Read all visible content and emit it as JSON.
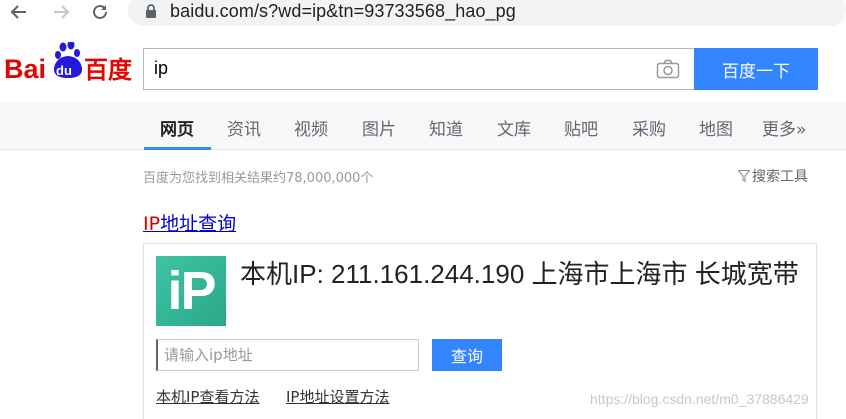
{
  "browser": {
    "url": "baidu.com/s?wd=ip&tn=93733568_hao_pg"
  },
  "header": {
    "logo_text_latin": "Bai",
    "logo_text_du": "du",
    "logo_text_cn": "百度",
    "search_value": "ip",
    "search_button": "百度一下"
  },
  "tabs": [
    {
      "label": "网页",
      "active": true
    },
    {
      "label": "资讯",
      "active": false
    },
    {
      "label": "视频",
      "active": false
    },
    {
      "label": "图片",
      "active": false
    },
    {
      "label": "知道",
      "active": false
    },
    {
      "label": "文库",
      "active": false
    },
    {
      "label": "贴吧",
      "active": false
    },
    {
      "label": "采购",
      "active": false
    },
    {
      "label": "地图",
      "active": false
    },
    {
      "label": "更多»",
      "active": false
    }
  ],
  "results": {
    "count_text": "百度为您找到相关结果约78,000,000个",
    "tools_label": "搜索工具"
  },
  "ip_card": {
    "title_em": "IP",
    "title_rest": "地址查询",
    "logo_text": "iP",
    "info_text": "本机IP: 211.161.244.190  上海市上海市 长城宽带",
    "input_placeholder": "请输入ip地址",
    "query_button": "查询",
    "link_1": "本机IP查看方法",
    "link_2": "IP地址设置方法"
  },
  "watermark": "https://blog.csdn.net/m0_37886429",
  "colors": {
    "accent": "#3385ff",
    "logo_red": "#e10602",
    "logo_blue": "#2319dc",
    "link": "#0000cc",
    "ip_logo": "#3ec4a4"
  }
}
